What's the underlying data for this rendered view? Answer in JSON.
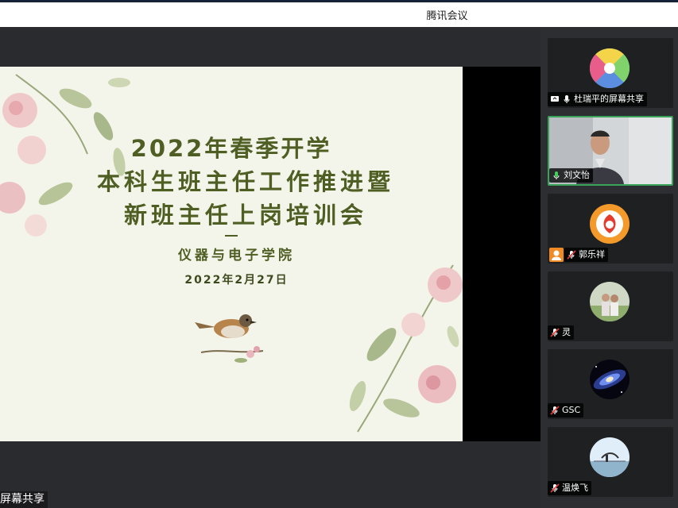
{
  "window": {
    "title": "腾讯会议"
  },
  "slide": {
    "title_line1": "2022年春季开学",
    "title_line2": "本科生班主任工作推进暨",
    "title_line3": "新班主任上岗培训会",
    "organizer": "仪器与电子学院",
    "date": "2022年2月27日"
  },
  "screen_share_label": "屏幕共享",
  "participants": [
    {
      "name": "杜瑞平的屏幕共享",
      "mic": "on",
      "sharing": true
    },
    {
      "name": "刘文怡",
      "mic": "on",
      "video": true,
      "speaking": true
    },
    {
      "name": "郭乐祥",
      "mic": "muted"
    },
    {
      "name": "灵",
      "mic": "muted"
    },
    {
      "name": "GSC",
      "mic": "muted"
    },
    {
      "name": "温焕飞",
      "mic": "muted"
    }
  ],
  "colors": {
    "accent": "#3aa35a",
    "slide_text": "#4f5f24",
    "slide_bg": "#f4f5ea"
  }
}
